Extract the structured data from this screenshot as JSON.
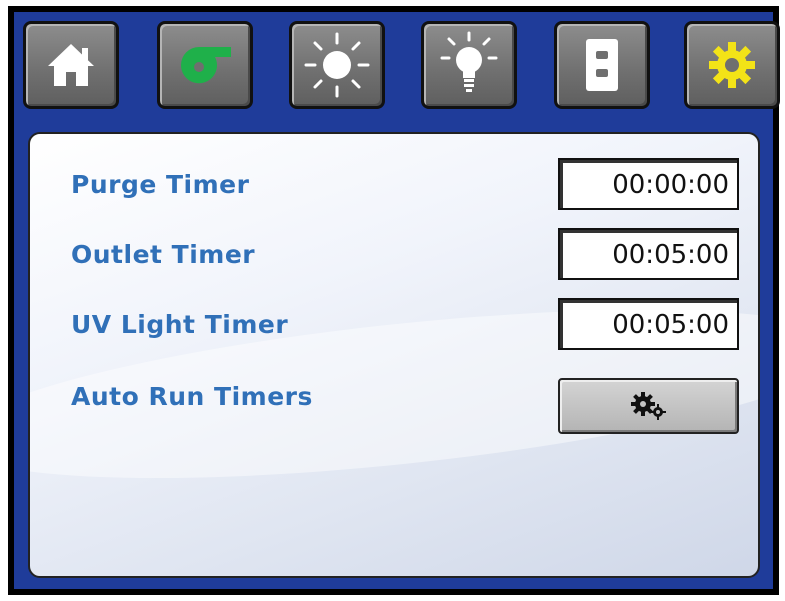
{
  "nav": {
    "tabs": [
      {
        "icon": "home-icon"
      },
      {
        "icon": "fan-icon",
        "accent": "#1fb04a"
      },
      {
        "icon": "sun-icon"
      },
      {
        "icon": "lightbulb-icon"
      },
      {
        "icon": "outlet-icon"
      },
      {
        "icon": "gear-icon",
        "accent": "#f3e317"
      }
    ]
  },
  "timers": {
    "purge": {
      "label": "Purge Timer",
      "value": "00:00:00"
    },
    "outlet": {
      "label": "Outlet Timer",
      "value": "00:05:00"
    },
    "uv": {
      "label": "UV Light Timer",
      "value": "00:05:00"
    },
    "auto_run": {
      "label": "Auto Run Timers",
      "icon": "gears-icon"
    }
  },
  "colors": {
    "bezel": "#1f3c9a",
    "label": "#3070b8"
  }
}
